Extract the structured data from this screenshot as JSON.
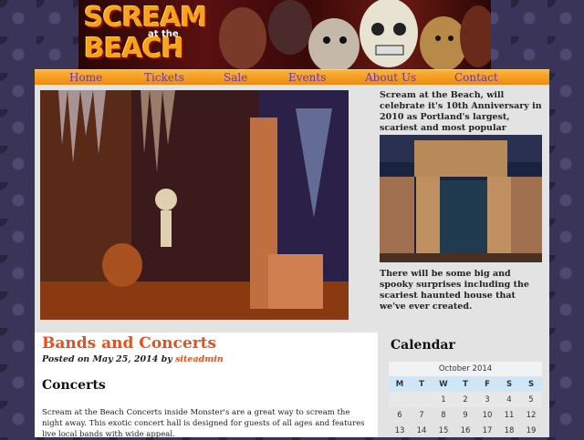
{
  "logo": {
    "line1": "SCREAM",
    "line2": "at the",
    "line3": "BEACH"
  },
  "nav": [
    "Home",
    "Tickets",
    "Sale",
    "Events",
    "About Us",
    "Contact"
  ],
  "sidebar": {
    "intro": "Scream at the Beach, will celebrate it's 10th Anniversary in 2010 as Portland's largest, scariest and most popular Halloween event.",
    "caption": "There will be some big and spooky surprises including the scariest haunted house that we've ever created."
  },
  "post": {
    "title": "Bands and Concerts",
    "meta_prefix": "Posted on May 25, 2014 by ",
    "author": "siteadmin",
    "heading": "Concerts",
    "body": "Scream at the Beach Concerts inside Monster's are a great way to scream the night away. This exotic concert hall is designed for guests of all ages and features live local bands with wide appeal."
  },
  "calendar": {
    "title": "Calendar",
    "month": "October 2014",
    "days": [
      "M",
      "T",
      "W",
      "T",
      "F",
      "S",
      "S"
    ],
    "week1": [
      "",
      "",
      "1",
      "2",
      "3",
      "4",
      "5"
    ],
    "week2": [
      "6",
      "7",
      "8",
      "9",
      "10",
      "11",
      "12"
    ],
    "week3": [
      "13",
      "14",
      "15",
      "16",
      "17",
      "18",
      "19"
    ]
  },
  "colors": {
    "accent": "#e8501a",
    "nav_bg": "#f5a020",
    "nav_text": "#6a36b8"
  }
}
